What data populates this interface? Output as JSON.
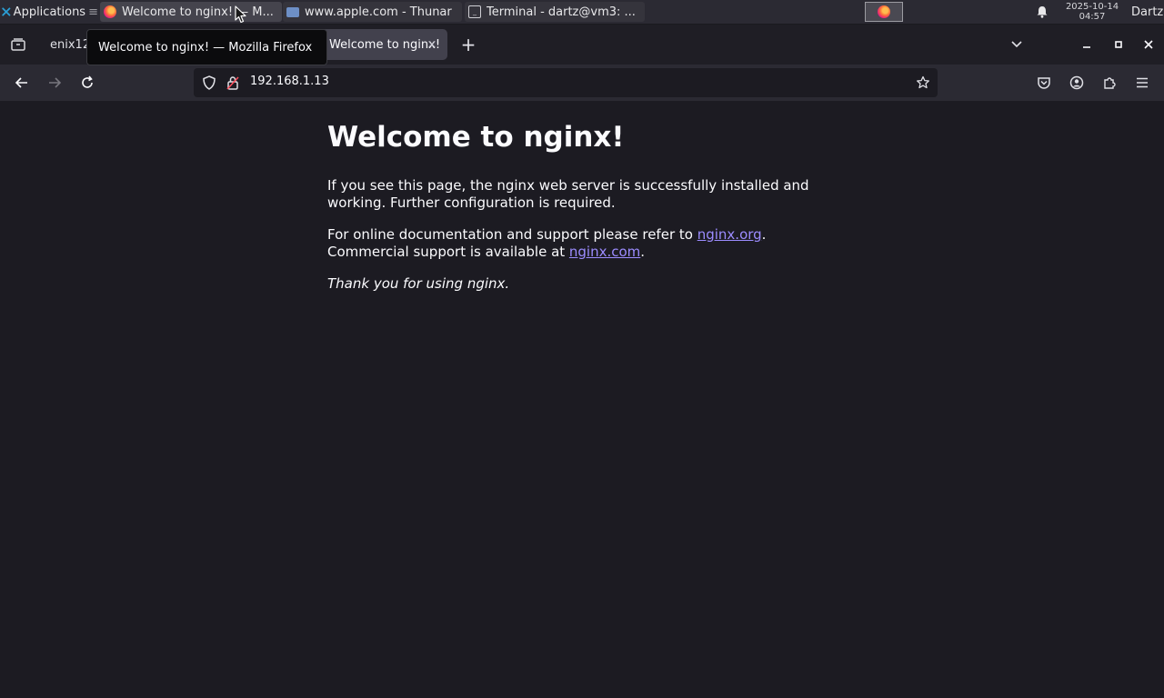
{
  "taskbar": {
    "apps_menu": "Applications",
    "tasks": [
      {
        "label": "Welcome to nginx! — M..."
      },
      {
        "label": "www.apple.com - Thunar"
      },
      {
        "label": "Terminal - dartz@vm3: ..."
      }
    ],
    "clock": {
      "date": "2025-10-14",
      "time": "04:57"
    },
    "user": "Dartz"
  },
  "browser": {
    "tabs": [
      {
        "title": "enix12"
      },
      {
        "title": "Welcome to nginx!",
        "active": true
      }
    ],
    "tooltip": "Welcome to nginx! — Mozilla Firefox",
    "url": "192.168.1.13",
    "new_tab_glyph": "+",
    "close_glyph": "×"
  },
  "page": {
    "heading": "Welcome to nginx!",
    "para1": "If you see this page, the nginx web server is successfully installed and working. Further configuration is required.",
    "para2_prefix": "For online documentation and support please refer to ",
    "link1": "nginx.org",
    "para2_mid": ".",
    "para2_line2": "Commercial support is available at ",
    "link2": "nginx.com",
    "para2_end": ".",
    "thanks": "Thank you for using nginx."
  },
  "colors": {
    "page_bg": "#1c1b22",
    "toolbar_bg": "#2b2a33",
    "link": "#9c8cff"
  }
}
